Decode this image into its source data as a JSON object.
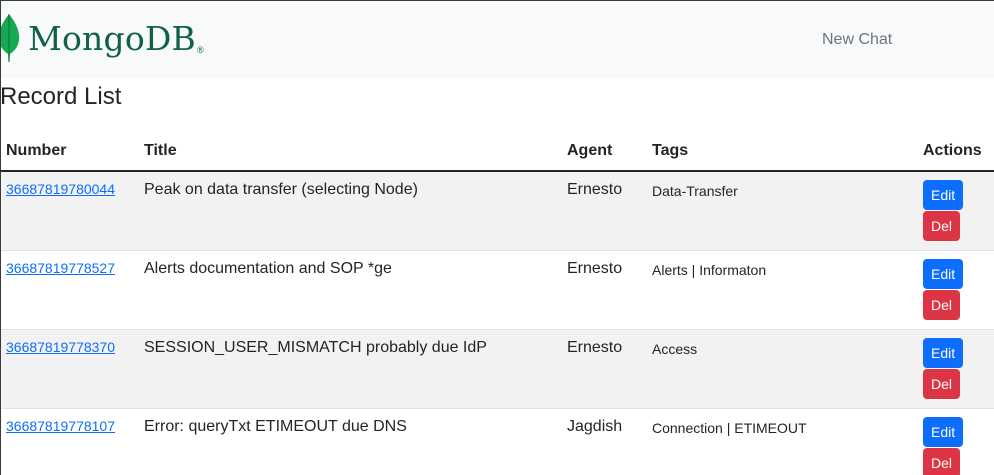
{
  "navbar": {
    "brand": "MongoDB",
    "brand_mark": "®",
    "brand_icon": "mongodb-leaf-icon",
    "link_new_chat": "New Chat"
  },
  "page": {
    "title": "Record List"
  },
  "colors": {
    "brand_green": "#116149",
    "leaf_green": "#13aa52",
    "link_blue": "#0d6efd",
    "edit_button": "#0d6efd",
    "delete_button": "#dc3545"
  },
  "table": {
    "headers": {
      "number": "Number",
      "title": "Title",
      "agent": "Agent",
      "tags": "Tags",
      "actions": "Actions"
    },
    "rows": [
      {
        "number": "36687819780044",
        "title": "Peak on data transfer (selecting Node)",
        "agent": "Ernesto",
        "tags": "Data-Transfer",
        "edit": "Edit",
        "del": "Del"
      },
      {
        "number": "36687819778527",
        "title": "Alerts documentation and SOP *ge",
        "agent": "Ernesto",
        "tags": "Alerts | Informaton",
        "edit": "Edit",
        "del": "Del"
      },
      {
        "number": "36687819778370",
        "title": "SESSION_USER_MISMATCH probably due IdP",
        "agent": "Ernesto",
        "tags": "Access",
        "edit": "Edit",
        "del": "Del"
      },
      {
        "number": "36687819778107",
        "title": "Error: queryTxt ETIMEOUT due DNS",
        "agent": "Jagdish",
        "tags": "Connection | ETIMEOUT",
        "edit": "Edit",
        "del": "Del"
      }
    ]
  }
}
